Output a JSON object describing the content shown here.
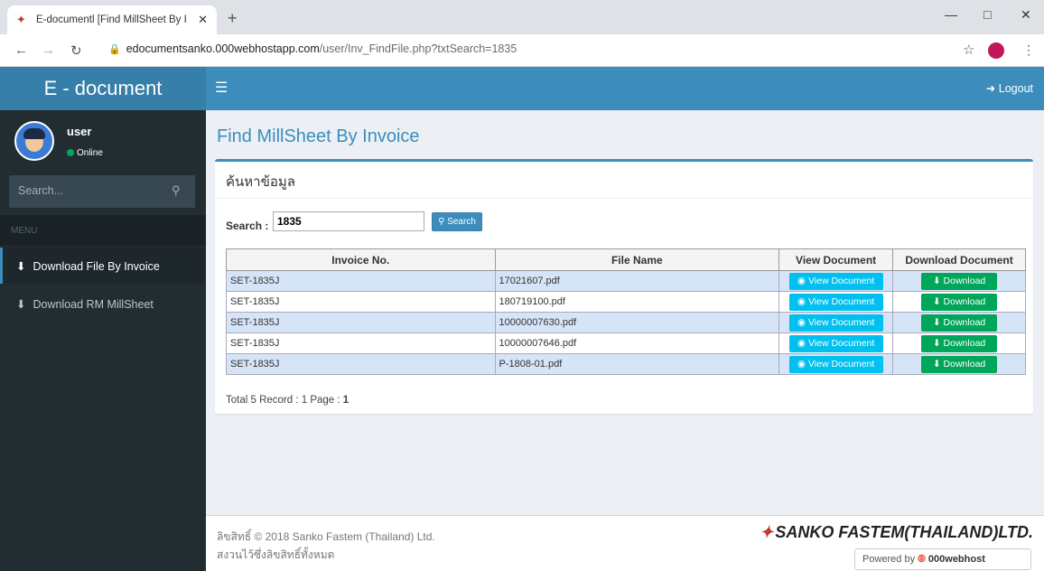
{
  "browser": {
    "tab_title": "E-documentl [Find MillSheet By I",
    "url_host": "edocumentsanko.000webhostapp.com",
    "url_path": "/user/Inv_FindFile.php?txtSearch=1835"
  },
  "header": {
    "logo": "E - document",
    "logout": "Logout"
  },
  "sidebar": {
    "user_name": "user",
    "status": "Online",
    "search_placeholder": "Search...",
    "menu_header": "MENU",
    "items": [
      {
        "label": "Download File By Invoice",
        "active": true
      },
      {
        "label": "Download RM MillSheet",
        "active": false
      }
    ]
  },
  "main": {
    "page_title": "Find MillSheet By Invoice",
    "box_title": "ค้นหาข้อมูล",
    "search_label": "Search :",
    "search_value": "1835",
    "search_button": "Search",
    "table": {
      "headers": [
        "Invoice No.",
        "File Name",
        "View Document",
        "Download Document"
      ],
      "rows": [
        {
          "invoice": "SET-1835J",
          "file": "17021607.pdf",
          "view": "View Document",
          "download": "Download"
        },
        {
          "invoice": "SET-1835J",
          "file": "180719100.pdf",
          "view": "View Document",
          "download": "Download"
        },
        {
          "invoice": "SET-1835J",
          "file": "10000007630.pdf",
          "view": "View Document",
          "download": "Download"
        },
        {
          "invoice": "SET-1835J",
          "file": "10000007646.pdf",
          "view": "View Document",
          "download": "Download"
        },
        {
          "invoice": "SET-1835J",
          "file": "P-1808-01.pdf",
          "view": "View Document",
          "download": "Download"
        }
      ]
    },
    "total_text": "Total 5 Record : 1 Page :",
    "page_number": "1"
  },
  "footer": {
    "copyright": "ลิขสิทธิ์ © 2018 Sanko Fastem (Thailand) Ltd.",
    "rights": "สงวนไว้ซึ่งลิขสิทธิ์ทั้งหมด",
    "brand": "SANKO FASTEM(THAILAND)LTD.",
    "powered_by": "Powered by",
    "powered_host": "000webhost"
  },
  "colors": {
    "primary": "#3c8dbc",
    "sidebar": "#222d32",
    "view_button": "#00c0ef",
    "download_button": "#00a65a"
  },
  "icons": [
    "favicon-icon",
    "close-icon",
    "plus-icon",
    "back-icon",
    "forward-icon",
    "reload-icon",
    "lock-icon",
    "star-icon",
    "menu-icon",
    "logout-icon",
    "search-icon",
    "download-icon",
    "eye-icon"
  ]
}
